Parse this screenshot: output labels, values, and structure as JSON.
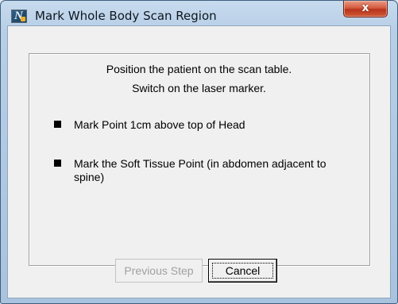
{
  "window": {
    "title": "Mark Whole Body Scan Region",
    "app_icon": "app-logo-icon",
    "close_glyph": "x"
  },
  "instructions": {
    "line1": "Position the patient on the scan table.",
    "line2": "Switch on the laser marker."
  },
  "steps": [
    {
      "label": "Mark Point 1cm above top of Head"
    },
    {
      "label": "Mark the Soft Tissue Point (in abdomen adjacent to spine)"
    }
  ],
  "buttons": {
    "previous_label": "Previous Step",
    "previous_enabled": false,
    "cancel_label": "Cancel"
  },
  "colors": {
    "frame": "#b7cee6",
    "close_button": "#c9462a",
    "client": "#f0f0f0",
    "disabled_text": "#a0a0a0"
  }
}
